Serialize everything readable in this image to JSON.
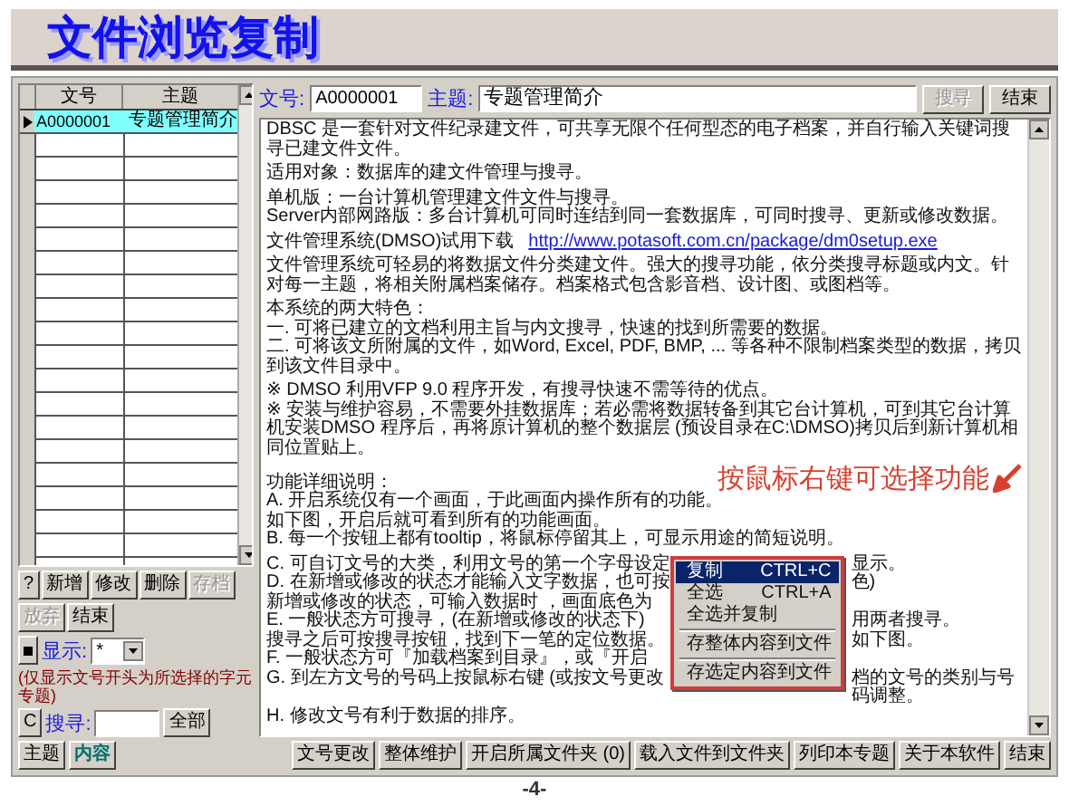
{
  "slide": {
    "title": "文件浏览复制",
    "page_number": "-4-"
  },
  "list": {
    "columns": [
      "文号",
      "主题"
    ],
    "rows": [
      {
        "doc_no": "A0000001",
        "subject": "专题管理简介",
        "selected": true
      }
    ],
    "buttons": [
      {
        "label": "?",
        "disabled": false
      },
      {
        "label": "新增",
        "disabled": false
      },
      {
        "label": "修改",
        "disabled": false
      },
      {
        "label": "删除",
        "disabled": false
      },
      {
        "label": "存档",
        "disabled": true
      },
      {
        "label": "放弃",
        "disabled": true
      },
      {
        "label": "结束",
        "disabled": false
      }
    ],
    "show": {
      "label": "显示:",
      "value": "*",
      "hint": "(仅显示文号开头为所选择的字元专题)"
    },
    "search": {
      "clear_button": "C",
      "label": "搜寻:",
      "modes": [
        {
          "label": "全部",
          "selected": false
        },
        {
          "label": "主题",
          "selected": false
        },
        {
          "label": "内容",
          "selected": true
        }
      ]
    }
  },
  "document": {
    "doc_no_label": "文号:",
    "doc_no": "A0000001",
    "subject_label": "主题:",
    "subject": "专题管理简介",
    "buttons": [
      {
        "label": "搜寻",
        "disabled": true
      },
      {
        "label": "结束",
        "disabled": false
      }
    ],
    "paragraphs": [
      [
        {
          "kind": "text",
          "text": "DBSC 是一套针对文件纪录建文件，可共享无限个任何型态的电子档案，并自行输入关键词搜寻已建文件文件。"
        }
      ],
      [
        {
          "kind": "text",
          "text": "适用对象：数据库的建文件管理与搜寻。"
        }
      ],
      [
        {
          "kind": "text",
          "text": "单机版：一台计算机管理建文件文件与搜寻。"
        },
        {
          "kind": "text",
          "text": "Server内部网路版：多台计算机可同时连结到同一套数据库，可同时搜寻、更新或修改数据。"
        }
      ],
      [
        {
          "kind": "link",
          "text": "文件管理系统(DMSO)试用下载",
          "url": "http://www.potasoft.com.cn/package/dm0setup.exe"
        }
      ],
      [
        {
          "kind": "text",
          "text": "文件管理系统可轻易的将数据文件分类建文件。强大的搜寻功能，依分类搜寻标题或内文。针对每一主题，将相关附属档案储存。档案格式包含影音档、设计图、或图档等。"
        }
      ],
      [
        {
          "kind": "text",
          "text": "本系统的两大特色："
        },
        {
          "kind": "text",
          "text": "一. 可将已建立的文档利用主旨与内文搜寻，快速的找到所需要的数据。"
        },
        {
          "kind": "text",
          "text": "二. 可将该文所附属的文件，如Word, Excel, PDF, BMP, ... 等各种不限制档案类型的数据，拷贝到该文件目录中。"
        }
      ],
      [
        {
          "kind": "text",
          "text": "※ DMSO 利用VFP 9.0 程序开发，有搜寻快速不需等待的优点。"
        },
        {
          "kind": "text",
          "text": "※ 安装与维护容易，不需要外挂数据库；若必需将数据转备到其它台计算机，可到其它台计算机安装DMSO 程序后，再将原计算机的整个数据层 (预设目录在C:\\DMSO)拷贝后到新计算机相同位置贴上。"
        }
      ],
      [
        {
          "kind": "callout",
          "text": "功能详细说明：",
          "callout": "按鼠标右键可选择功能"
        },
        {
          "kind": "text",
          "text": "A. 开启系统仅有一个画面，于此画面内操作所有的功能。"
        },
        {
          "kind": "text",
          "text": "如下图，开启后就可看到所有的功能画面。"
        },
        {
          "kind": "text",
          "text": "B. 每一个按钮上都有tooltip，将鼠标停留其上，可显示用途的简短说明。"
        }
      ]
    ],
    "covered_lines": [
      {
        "left": "C. 可自订文号的大类，利用文号的第一个字母设定",
        "right": "显示。"
      },
      {
        "left": "D. 在新增或修改的状态才能输入文字数据，也可按",
        "right": "色)"
      },
      {
        "left": "新增或修改的状态，可输入数据时 ，画面底色为"
      },
      {
        "left": "E. 一般状态方可搜寻，(在新增或修改的状态下)",
        "right": "用两者搜寻。"
      },
      {
        "left": "搜寻之后可按搜寻按钮，找到下一笔的定位数据。",
        "right": "如下图。"
      },
      {
        "left": "F. 一般状态方可『加载档案到目录』，或『开启"
      },
      {
        "left": "G. 到左方文号的号码上按鼠标右键 (或按文号更改",
        "right": "档的文号的类别与号码调整。"
      },
      {
        "left": "H. 修改文号有利于数据的排序。"
      }
    ],
    "bottom_buttons": [
      {
        "label": "文号更改"
      },
      {
        "label": "整体维护"
      },
      {
        "label": "开启所属文件夹 (0)"
      },
      {
        "label": "载入文件到文件夹"
      },
      {
        "label": "列印本专题"
      },
      {
        "label": "关于本软件"
      },
      {
        "label": "结束"
      }
    ]
  },
  "context_menu": {
    "items": [
      {
        "label": "复制",
        "shortcut": "CTRL+C",
        "selected": true,
        "separator_before": false
      },
      {
        "label": "全选",
        "shortcut": "CTRL+A",
        "selected": false,
        "separator_before": false
      },
      {
        "label": "全选并复制",
        "selected": false,
        "separator_before": false
      },
      {
        "label": "存整体内容到文件",
        "selected": false,
        "separator_before": true
      },
      {
        "label": "存选定内容到文件",
        "selected": false,
        "separator_before": true
      }
    ]
  }
}
